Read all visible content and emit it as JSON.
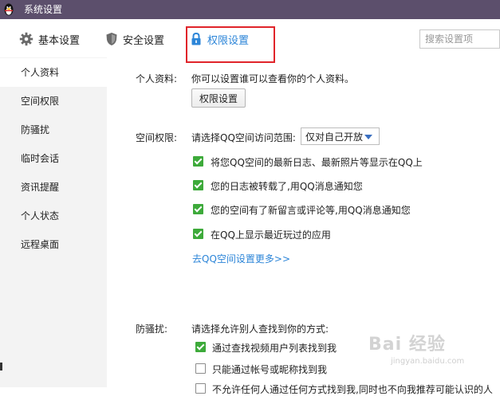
{
  "window": {
    "title": "系统设置"
  },
  "tabs": [
    {
      "label": "基本设置",
      "icon": "gear-icon"
    },
    {
      "label": "安全设置",
      "icon": "shield-icon"
    },
    {
      "label": "权限设置",
      "icon": "lock-icon",
      "active": true
    }
  ],
  "search": {
    "placeholder": "搜索设置项"
  },
  "sidebar": {
    "items": [
      {
        "label": "个人资料",
        "active": true
      },
      {
        "label": "空间权限"
      },
      {
        "label": "防骚扰"
      },
      {
        "label": "临时会话"
      },
      {
        "label": "资讯提醒"
      },
      {
        "label": "个人状态"
      },
      {
        "label": "远程桌面"
      }
    ]
  },
  "profile": {
    "label": "个人资料:",
    "description": "你可以设置谁可以查看你的个人资料。",
    "button": "权限设置"
  },
  "space": {
    "label": "空间权限:",
    "range_label": "请选择QQ空间访问范围:",
    "range_value": "仅对自己开放",
    "options": [
      {
        "label": "将您QQ空间的最新日志、最新照片等显示在QQ上",
        "checked": true
      },
      {
        "label": "您的日志被转载了,用QQ消息通知您",
        "checked": true
      },
      {
        "label": "您的空间有了新留言或评论等,用QQ消息通知您",
        "checked": true
      },
      {
        "label": "在QQ上显示最近玩过的应用",
        "checked": true
      }
    ],
    "more_link": "去QQ空间设置更多>>"
  },
  "harassment": {
    "label": "防骚扰:",
    "prompt": "请选择允许别人查找到你的方式:",
    "options": [
      {
        "label": "通过查找视频用户列表找到我",
        "checked": true
      },
      {
        "label": "只能通过帐号或昵称找到我",
        "checked": false
      },
      {
        "label": "不允许任何人通过任何方式找到我,同时也不向我推荐可能认识的人",
        "checked": false
      }
    ]
  },
  "watermark": {
    "logo": "Bai 经验",
    "sub": "jingyan.baidu.com"
  },
  "colors": {
    "titlebar": "#5c4f6c",
    "accent": "#2c85d8",
    "checkbox": "#3daa3a",
    "highlight": "#e0242a"
  }
}
